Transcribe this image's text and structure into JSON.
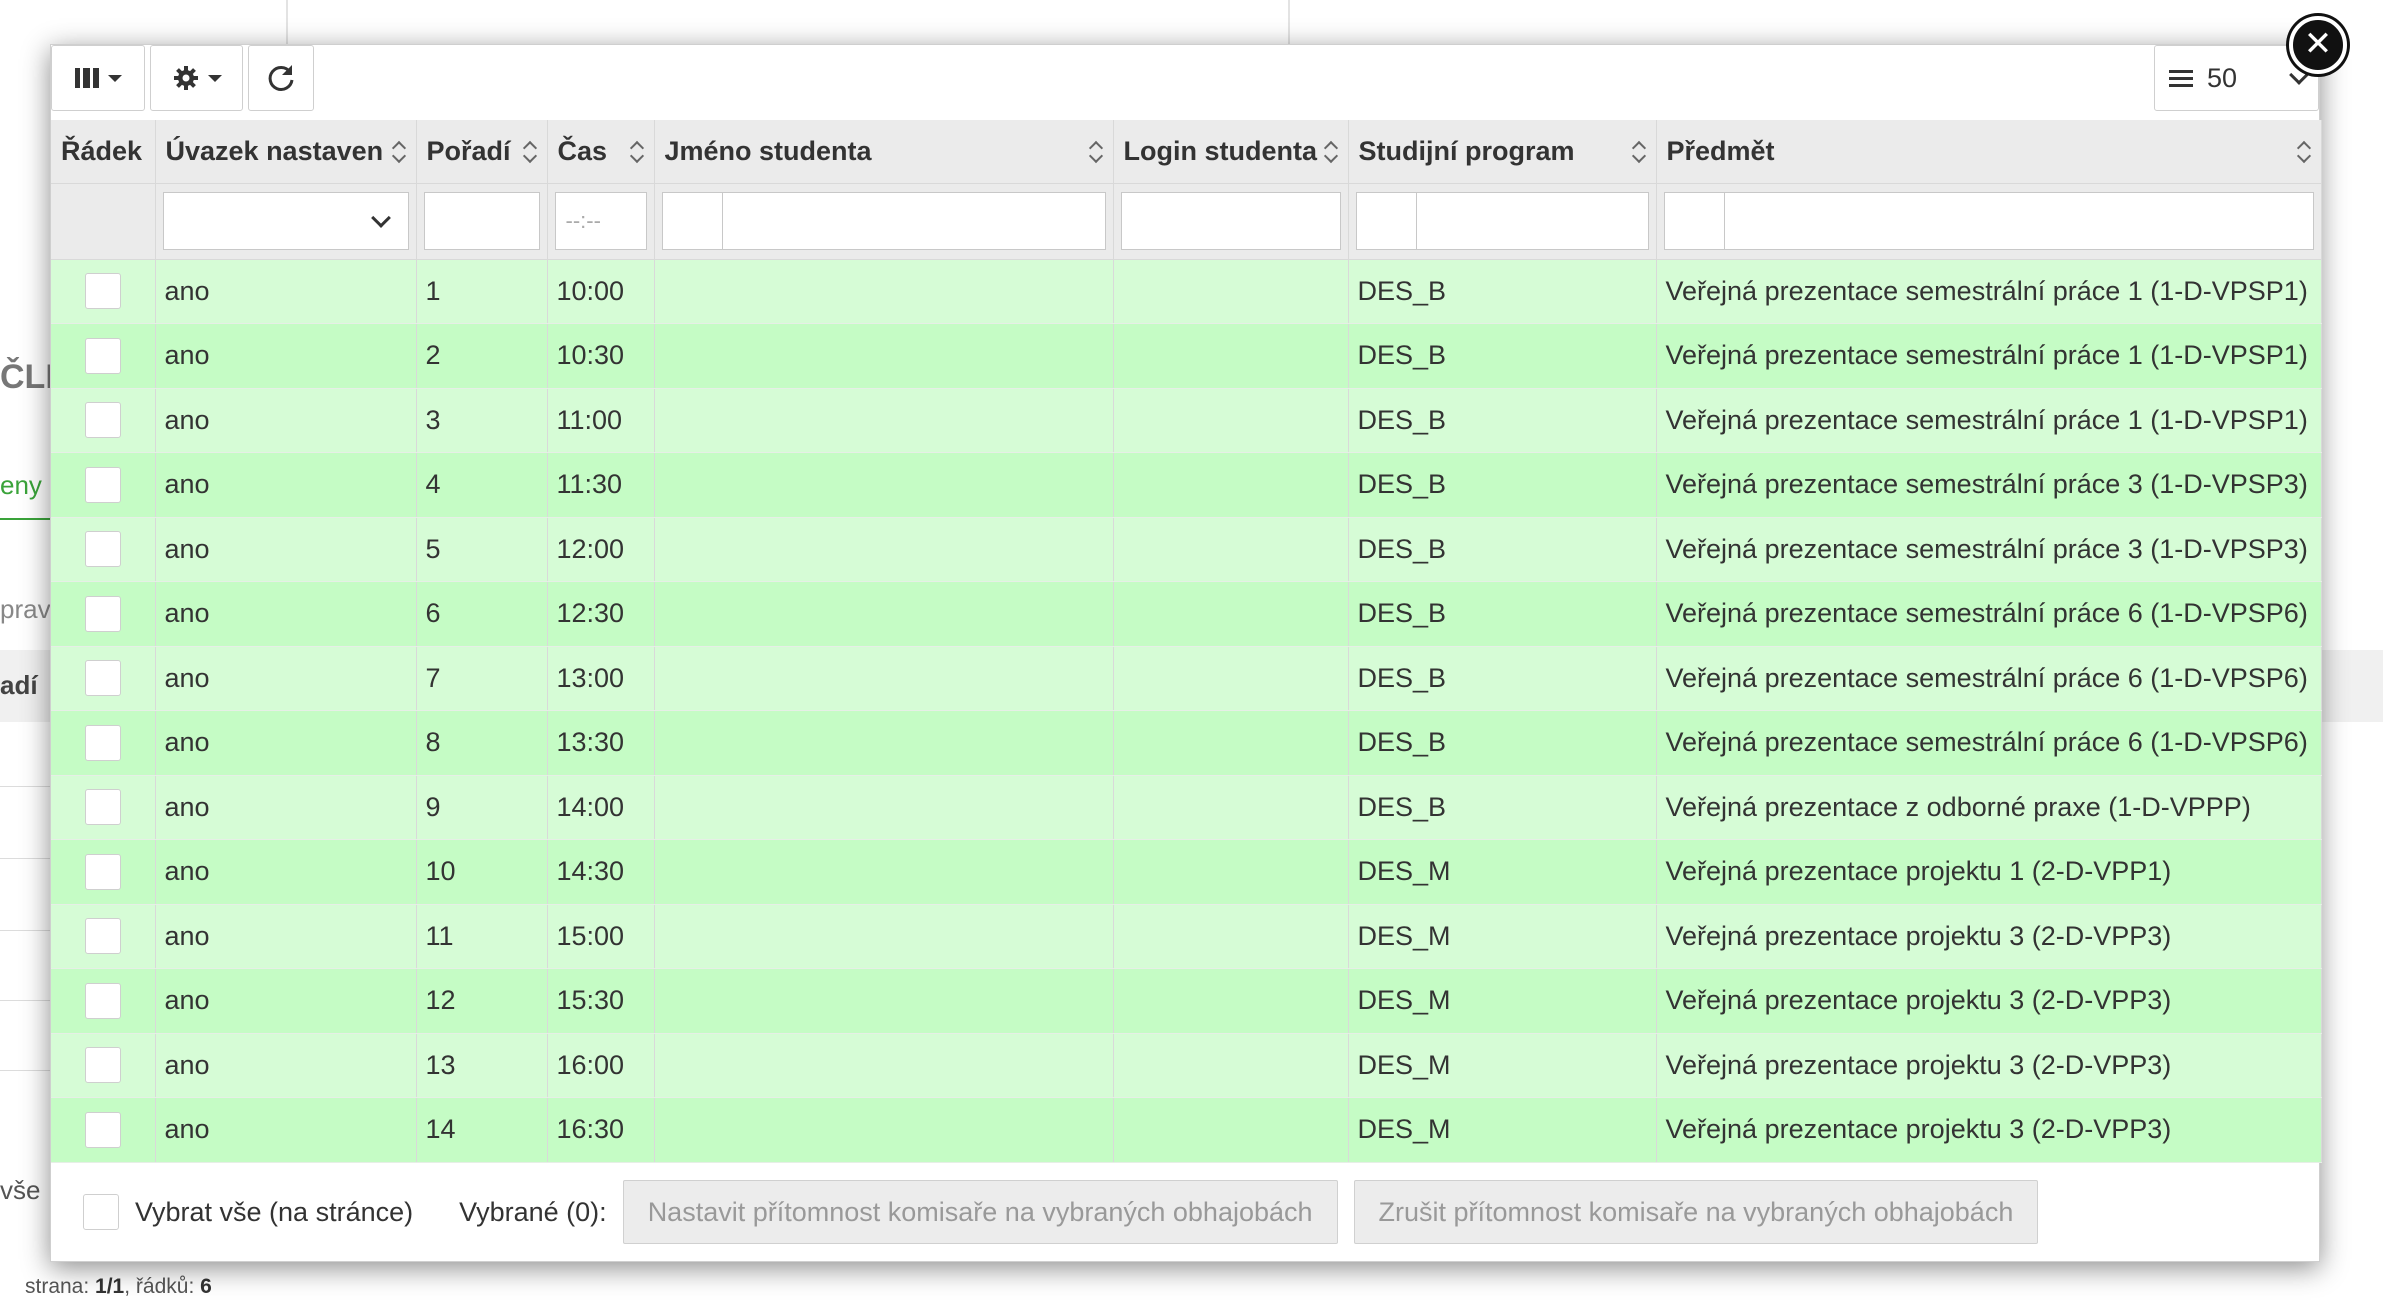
{
  "background": {
    "fragments": [
      "ČLE",
      "eny",
      "prav",
      "adí",
      "vše"
    ],
    "footer": {
      "prefix": "strana: ",
      "page": "1/1",
      "sep": ", řádků: ",
      "rows": "6"
    }
  },
  "toolbar": {
    "columns_icon": "columns-icon",
    "settings_icon": "gear-icon",
    "refresh_icon": "refresh-icon",
    "page_size": "50"
  },
  "table": {
    "columns": [
      "Řádek",
      "Úvazek nastaven",
      "Pořadí",
      "Čas",
      "Jméno studenta",
      "Login studenta",
      "Studijní program",
      "Předmět"
    ],
    "time_placeholder": "--:--",
    "rows": [
      {
        "uvazek": "ano",
        "poradi": "1",
        "cas": "10:00",
        "jmeno": "",
        "login": "",
        "program": "DES_B",
        "predmet": "Veřejná prezentace semestrální práce 1 (1-D-VPSP1)"
      },
      {
        "uvazek": "ano",
        "poradi": "2",
        "cas": "10:30",
        "jmeno": "",
        "login": "",
        "program": "DES_B",
        "predmet": "Veřejná prezentace semestrální práce 1 (1-D-VPSP1)"
      },
      {
        "uvazek": "ano",
        "poradi": "3",
        "cas": "11:00",
        "jmeno": "",
        "login": "",
        "program": "DES_B",
        "predmet": "Veřejná prezentace semestrální práce 1 (1-D-VPSP1)"
      },
      {
        "uvazek": "ano",
        "poradi": "4",
        "cas": "11:30",
        "jmeno": "",
        "login": "",
        "program": "DES_B",
        "predmet": "Veřejná prezentace semestrální práce 3 (1-D-VPSP3)"
      },
      {
        "uvazek": "ano",
        "poradi": "5",
        "cas": "12:00",
        "jmeno": "",
        "login": "",
        "program": "DES_B",
        "predmet": "Veřejná prezentace semestrální práce 3 (1-D-VPSP3)"
      },
      {
        "uvazek": "ano",
        "poradi": "6",
        "cas": "12:30",
        "jmeno": "",
        "login": "",
        "program": "DES_B",
        "predmet": "Veřejná prezentace semestrální práce 6 (1-D-VPSP6)"
      },
      {
        "uvazek": "ano",
        "poradi": "7",
        "cas": "13:00",
        "jmeno": "",
        "login": "",
        "program": "DES_B",
        "predmet": "Veřejná prezentace semestrální práce 6 (1-D-VPSP6)"
      },
      {
        "uvazek": "ano",
        "poradi": "8",
        "cas": "13:30",
        "jmeno": "",
        "login": "",
        "program": "DES_B",
        "predmet": "Veřejná prezentace semestrální práce 6 (1-D-VPSP6)"
      },
      {
        "uvazek": "ano",
        "poradi": "9",
        "cas": "14:00",
        "jmeno": "",
        "login": "",
        "program": "DES_B",
        "predmet": "Veřejná prezentace z odborné praxe (1-D-VPPP)"
      },
      {
        "uvazek": "ano",
        "poradi": "10",
        "cas": "14:30",
        "jmeno": "",
        "login": "",
        "program": "DES_M",
        "predmet": "Veřejná prezentace projektu 1 (2-D-VPP1)"
      },
      {
        "uvazek": "ano",
        "poradi": "11",
        "cas": "15:00",
        "jmeno": "",
        "login": "",
        "program": "DES_M",
        "predmet": "Veřejná prezentace projektu 3 (2-D-VPP3)"
      },
      {
        "uvazek": "ano",
        "poradi": "12",
        "cas": "15:30",
        "jmeno": "",
        "login": "",
        "program": "DES_M",
        "predmet": "Veřejná prezentace projektu 3 (2-D-VPP3)"
      },
      {
        "uvazek": "ano",
        "poradi": "13",
        "cas": "16:00",
        "jmeno": "",
        "login": "",
        "program": "DES_M",
        "predmet": "Veřejná prezentace projektu 3 (2-D-VPP3)"
      },
      {
        "uvazek": "ano",
        "poradi": "14",
        "cas": "16:30",
        "jmeno": "",
        "login": "",
        "program": "DES_M",
        "predmet": "Veřejná prezentace projektu 3 (2-D-VPP3)"
      }
    ]
  },
  "footer": {
    "select_all_label": "Vybrat vše (na stránce)",
    "selected_label": "Vybrané (0):",
    "set_button": "Nastavit přítomnost komisaře na vybraných obhajobách",
    "unset_button": "Zrušit přítomnost komisaře na vybraných obhajobách"
  },
  "close_icon": "close-icon"
}
